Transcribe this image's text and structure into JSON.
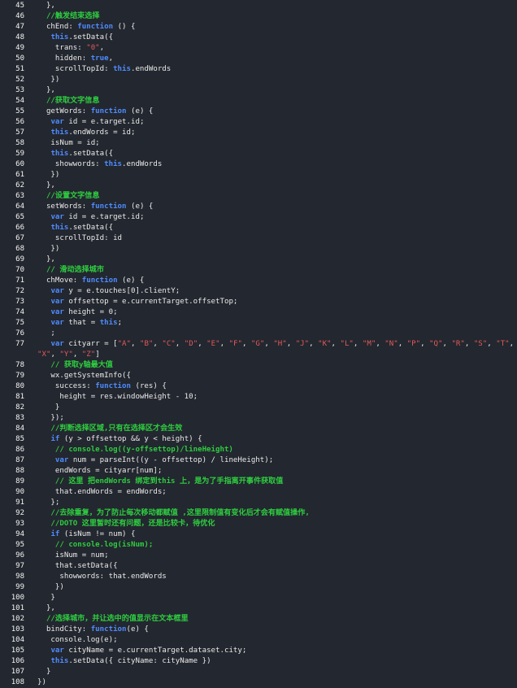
{
  "editor": {
    "colors": {
      "background": "#23272f",
      "keyword": "#4f8cff",
      "string": "#e05a5a",
      "comment": "#2ecc40",
      "text": "#eaeaea",
      "gutter_line": "#e9c62a"
    },
    "lines": [
      {
        "n": "45",
        "tokens": [
          {
            "t": "txt",
            "v": "  },"
          }
        ]
      },
      {
        "n": "46",
        "tokens": [
          {
            "t": "com",
            "v": "  //触发结束选择"
          }
        ]
      },
      {
        "n": "47",
        "tokens": [
          {
            "t": "txt",
            "v": "  chEnd: "
          },
          {
            "t": "kw",
            "v": "function"
          },
          {
            "t": "txt",
            "v": " () {"
          }
        ]
      },
      {
        "n": "48",
        "tokens": [
          {
            "t": "txt",
            "v": "   "
          },
          {
            "t": "kw",
            "v": "this"
          },
          {
            "t": "txt",
            "v": ".setData({"
          }
        ]
      },
      {
        "n": "49",
        "tokens": [
          {
            "t": "txt",
            "v": "    trans: "
          },
          {
            "t": "str",
            "v": "\"0\""
          },
          {
            "t": "txt",
            "v": ","
          }
        ]
      },
      {
        "n": "50",
        "tokens": [
          {
            "t": "txt",
            "v": "    hidden: "
          },
          {
            "t": "kw",
            "v": "true"
          },
          {
            "t": "txt",
            "v": ","
          }
        ]
      },
      {
        "n": "51",
        "tokens": [
          {
            "t": "txt",
            "v": "    scrollTopId: "
          },
          {
            "t": "kw",
            "v": "this"
          },
          {
            "t": "txt",
            "v": ".endWords"
          }
        ]
      },
      {
        "n": "52",
        "tokens": [
          {
            "t": "txt",
            "v": "   })"
          }
        ]
      },
      {
        "n": "53",
        "tokens": [
          {
            "t": "txt",
            "v": "  },"
          }
        ]
      },
      {
        "n": "54",
        "tokens": [
          {
            "t": "com",
            "v": "  //获取文字信息"
          }
        ]
      },
      {
        "n": "55",
        "tokens": [
          {
            "t": "txt",
            "v": "  getWords: "
          },
          {
            "t": "kw",
            "v": "function"
          },
          {
            "t": "txt",
            "v": " (e) {"
          }
        ]
      },
      {
        "n": "56",
        "tokens": [
          {
            "t": "txt",
            "v": "   "
          },
          {
            "t": "kw",
            "v": "var"
          },
          {
            "t": "txt",
            "v": " id = e.target.id;"
          }
        ]
      },
      {
        "n": "57",
        "tokens": [
          {
            "t": "txt",
            "v": "   "
          },
          {
            "t": "kw",
            "v": "this"
          },
          {
            "t": "txt",
            "v": ".endWords = id;"
          }
        ]
      },
      {
        "n": "58",
        "tokens": [
          {
            "t": "txt",
            "v": "   isNum = id;"
          }
        ]
      },
      {
        "n": "59",
        "tokens": [
          {
            "t": "txt",
            "v": "   "
          },
          {
            "t": "kw",
            "v": "this"
          },
          {
            "t": "txt",
            "v": ".setData({"
          }
        ]
      },
      {
        "n": "60",
        "tokens": [
          {
            "t": "txt",
            "v": "    showwords: "
          },
          {
            "t": "kw",
            "v": "this"
          },
          {
            "t": "txt",
            "v": ".endWords"
          }
        ]
      },
      {
        "n": "61",
        "tokens": [
          {
            "t": "txt",
            "v": "   })"
          }
        ]
      },
      {
        "n": "62",
        "tokens": [
          {
            "t": "txt",
            "v": "  },"
          }
        ]
      },
      {
        "n": "63",
        "tokens": [
          {
            "t": "com",
            "v": "  //设置文字信息"
          }
        ]
      },
      {
        "n": "64",
        "tokens": [
          {
            "t": "txt",
            "v": "  setWords: "
          },
          {
            "t": "kw",
            "v": "function"
          },
          {
            "t": "txt",
            "v": " (e) {"
          }
        ]
      },
      {
        "n": "65",
        "tokens": [
          {
            "t": "txt",
            "v": "   "
          },
          {
            "t": "kw",
            "v": "var"
          },
          {
            "t": "txt",
            "v": " id = e.target.id;"
          }
        ]
      },
      {
        "n": "66",
        "tokens": [
          {
            "t": "txt",
            "v": "   "
          },
          {
            "t": "kw",
            "v": "this"
          },
          {
            "t": "txt",
            "v": ".setData({"
          }
        ]
      },
      {
        "n": "67",
        "tokens": [
          {
            "t": "txt",
            "v": "    scrollTopId: id"
          }
        ]
      },
      {
        "n": "68",
        "tokens": [
          {
            "t": "txt",
            "v": "   })"
          }
        ]
      },
      {
        "n": "69",
        "tokens": [
          {
            "t": "txt",
            "v": "  },"
          }
        ]
      },
      {
        "n": "70",
        "tokens": [
          {
            "t": "com",
            "v": "  // 滑动选择城市"
          }
        ]
      },
      {
        "n": "71",
        "tokens": [
          {
            "t": "txt",
            "v": "  chMove: "
          },
          {
            "t": "kw",
            "v": "function"
          },
          {
            "t": "txt",
            "v": " (e) {"
          }
        ]
      },
      {
        "n": "72",
        "tokens": [
          {
            "t": "txt",
            "v": "   "
          },
          {
            "t": "kw",
            "v": "var"
          },
          {
            "t": "txt",
            "v": " y = e.touches[0].clientY;"
          }
        ]
      },
      {
        "n": "73",
        "tokens": [
          {
            "t": "txt",
            "v": "   "
          },
          {
            "t": "kw",
            "v": "var"
          },
          {
            "t": "txt",
            "v": " offsettop = e.currentTarget.offsetTop;"
          }
        ]
      },
      {
        "n": "74",
        "tokens": [
          {
            "t": "txt",
            "v": "   "
          },
          {
            "t": "kw",
            "v": "var"
          },
          {
            "t": "txt",
            "v": " height = 0;"
          }
        ]
      },
      {
        "n": "75",
        "tokens": [
          {
            "t": "txt",
            "v": "   "
          },
          {
            "t": "kw",
            "v": "var"
          },
          {
            "t": "txt",
            "v": " that = "
          },
          {
            "t": "kw",
            "v": "this"
          },
          {
            "t": "txt",
            "v": ";"
          }
        ]
      },
      {
        "n": "76",
        "tokens": [
          {
            "t": "txt",
            "v": "   ;"
          }
        ]
      },
      {
        "n": "77",
        "tokens": [
          {
            "t": "txt",
            "v": "   "
          },
          {
            "t": "kw",
            "v": "var"
          },
          {
            "t": "txt",
            "v": " cityarr = ["
          },
          {
            "t": "str",
            "v": "\"A\""
          },
          {
            "t": "txt",
            "v": ", "
          },
          {
            "t": "str",
            "v": "\"B\""
          },
          {
            "t": "txt",
            "v": ", "
          },
          {
            "t": "str",
            "v": "\"C\""
          },
          {
            "t": "txt",
            "v": ", "
          },
          {
            "t": "str",
            "v": "\"D\""
          },
          {
            "t": "txt",
            "v": ", "
          },
          {
            "t": "str",
            "v": "\"E\""
          },
          {
            "t": "txt",
            "v": ", "
          },
          {
            "t": "str",
            "v": "\"F\""
          },
          {
            "t": "txt",
            "v": ", "
          },
          {
            "t": "str",
            "v": "\"G\""
          },
          {
            "t": "txt",
            "v": ", "
          },
          {
            "t": "str",
            "v": "\"H\""
          },
          {
            "t": "txt",
            "v": ", "
          },
          {
            "t": "str",
            "v": "\"J\""
          },
          {
            "t": "txt",
            "v": ", "
          },
          {
            "t": "str",
            "v": "\"K\""
          },
          {
            "t": "txt",
            "v": ", "
          },
          {
            "t": "str",
            "v": "\"L\""
          },
          {
            "t": "txt",
            "v": ", "
          },
          {
            "t": "str",
            "v": "\"M\""
          },
          {
            "t": "txt",
            "v": ", "
          },
          {
            "t": "str",
            "v": "\"N\""
          },
          {
            "t": "txt",
            "v": ", "
          },
          {
            "t": "str",
            "v": "\"P\""
          },
          {
            "t": "txt",
            "v": ", "
          },
          {
            "t": "str",
            "v": "\"Q\""
          },
          {
            "t": "txt",
            "v": ", "
          },
          {
            "t": "str",
            "v": "\"R\""
          },
          {
            "t": "txt",
            "v": ", "
          },
          {
            "t": "str",
            "v": "\"S\""
          },
          {
            "t": "txt",
            "v": ", "
          },
          {
            "t": "str",
            "v": "\"T\""
          },
          {
            "t": "txt",
            "v": ", "
          },
          {
            "t": "str",
            "v": "\"W\""
          },
          {
            "t": "txt",
            "v": ","
          }
        ]
      },
      {
        "n": "",
        "tokens": [
          {
            "t": "str",
            "v": "\"X\""
          },
          {
            "t": "txt",
            "v": ", "
          },
          {
            "t": "str",
            "v": "\"Y\""
          },
          {
            "t": "txt",
            "v": ", "
          },
          {
            "t": "str",
            "v": "\"Z\""
          },
          {
            "t": "txt",
            "v": "]"
          }
        ]
      },
      {
        "n": "78",
        "tokens": [
          {
            "t": "com",
            "v": "   // 获取y轴最大值"
          }
        ]
      },
      {
        "n": "79",
        "tokens": [
          {
            "t": "txt",
            "v": "   wx.getSystemInfo({"
          }
        ]
      },
      {
        "n": "80",
        "tokens": [
          {
            "t": "txt",
            "v": "    success: "
          },
          {
            "t": "kw",
            "v": "function"
          },
          {
            "t": "txt",
            "v": " (res) {"
          }
        ]
      },
      {
        "n": "81",
        "tokens": [
          {
            "t": "txt",
            "v": "     height = res.windowHeight - 10;"
          }
        ]
      },
      {
        "n": "82",
        "tokens": [
          {
            "t": "txt",
            "v": "    }"
          }
        ]
      },
      {
        "n": "83",
        "tokens": [
          {
            "t": "txt",
            "v": "   });"
          }
        ]
      },
      {
        "n": "84",
        "tokens": [
          {
            "t": "com",
            "v": "   //判断选择区域,只有在选择区才会生效"
          }
        ]
      },
      {
        "n": "85",
        "tokens": [
          {
            "t": "txt",
            "v": "   "
          },
          {
            "t": "kw",
            "v": "if"
          },
          {
            "t": "txt",
            "v": " (y > offsettop && y < height) {"
          }
        ]
      },
      {
        "n": "86",
        "tokens": [
          {
            "t": "com",
            "v": "    // console.log((y-offsettop)/lineHeight)"
          }
        ]
      },
      {
        "n": "87",
        "tokens": [
          {
            "t": "txt",
            "v": "    "
          },
          {
            "t": "kw",
            "v": "var"
          },
          {
            "t": "txt",
            "v": " num = parseInt((y - offsettop) / lineHeight);"
          }
        ]
      },
      {
        "n": "88",
        "tokens": [
          {
            "t": "txt",
            "v": "    endWords = cityarr[num];"
          }
        ]
      },
      {
        "n": "89",
        "tokens": [
          {
            "t": "com",
            "v": "    // 这里 把endWords 绑定到this 上，是为了手指离开事件获取值"
          }
        ]
      },
      {
        "n": "90",
        "tokens": [
          {
            "t": "txt",
            "v": "    that.endWords = endWords;"
          }
        ]
      },
      {
        "n": "91",
        "tokens": [
          {
            "t": "txt",
            "v": "   };"
          }
        ]
      },
      {
        "n": "92",
        "tokens": [
          {
            "t": "com",
            "v": "   //去除重复，为了防止每次移动都赋值 ,这里限制值有变化后才会有赋值操作,"
          }
        ]
      },
      {
        "n": "93",
        "tokens": [
          {
            "t": "com",
            "v": "   //DOTO 这里暂时还有问题，还是比较卡，待优化"
          }
        ]
      },
      {
        "n": "94",
        "tokens": [
          {
            "t": "txt",
            "v": "   "
          },
          {
            "t": "kw",
            "v": "if"
          },
          {
            "t": "txt",
            "v": " (isNum != num) {"
          }
        ]
      },
      {
        "n": "95",
        "tokens": [
          {
            "t": "com",
            "v": "    // console.log(isNum);"
          }
        ]
      },
      {
        "n": "96",
        "tokens": [
          {
            "t": "txt",
            "v": "    isNum = num;"
          }
        ]
      },
      {
        "n": "97",
        "tokens": [
          {
            "t": "txt",
            "v": "    that.setData({"
          }
        ]
      },
      {
        "n": "98",
        "tokens": [
          {
            "t": "txt",
            "v": "     showwords: that.endWords"
          }
        ]
      },
      {
        "n": "99",
        "tokens": [
          {
            "t": "txt",
            "v": "    })"
          }
        ]
      },
      {
        "n": "100",
        "tokens": [
          {
            "t": "txt",
            "v": "   }"
          }
        ]
      },
      {
        "n": "101",
        "tokens": [
          {
            "t": "txt",
            "v": "  },"
          }
        ]
      },
      {
        "n": "102",
        "tokens": [
          {
            "t": "com",
            "v": "  //选择城市，并让选中的值显示在文本框里"
          }
        ]
      },
      {
        "n": "103",
        "tokens": [
          {
            "t": "txt",
            "v": "  bindCity: "
          },
          {
            "t": "kw",
            "v": "function"
          },
          {
            "t": "txt",
            "v": "(e) {"
          }
        ]
      },
      {
        "n": "104",
        "tokens": [
          {
            "t": "txt",
            "v": "   console.log(e);"
          }
        ]
      },
      {
        "n": "105",
        "tokens": [
          {
            "t": "txt",
            "v": "   "
          },
          {
            "t": "kw",
            "v": "var"
          },
          {
            "t": "txt",
            "v": " cityName = e.currentTarget.dataset.city;"
          }
        ]
      },
      {
        "n": "106",
        "tokens": [
          {
            "t": "txt",
            "v": "   "
          },
          {
            "t": "kw",
            "v": "this"
          },
          {
            "t": "txt",
            "v": ".setData({ cityName: cityName })"
          }
        ]
      },
      {
        "n": "107",
        "tokens": [
          {
            "t": "txt",
            "v": "  }"
          }
        ]
      },
      {
        "n": "108",
        "tokens": [
          {
            "t": "txt",
            "v": "})"
          }
        ]
      }
    ]
  }
}
